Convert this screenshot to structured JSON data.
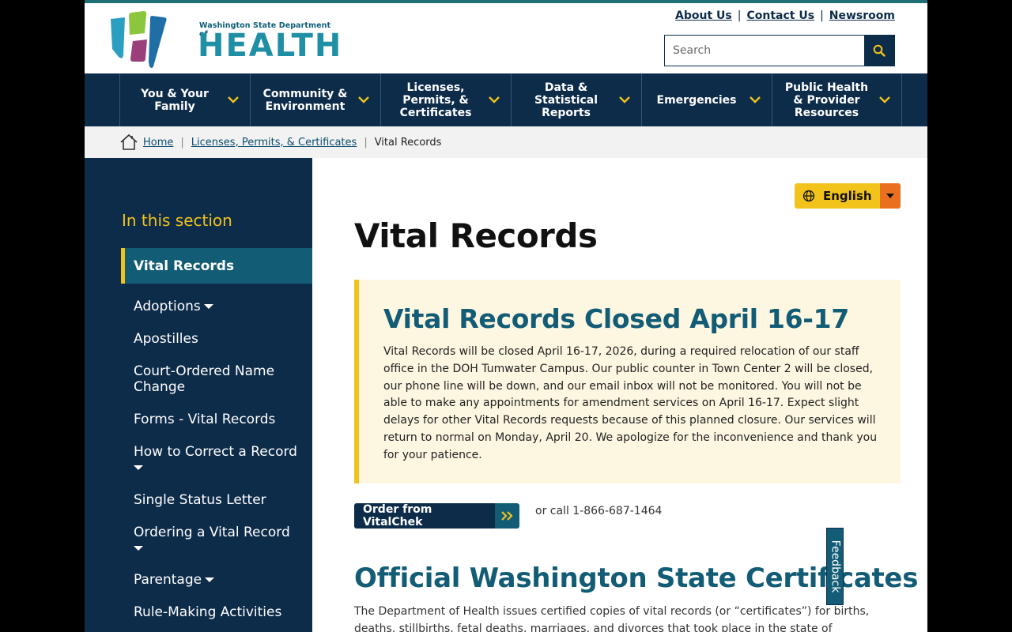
{
  "header": {
    "logo_small": "Washington State Department of",
    "logo_big": "HEALTH",
    "utility_links": [
      "About Us",
      "Contact Us",
      "Newsroom"
    ],
    "search_placeholder": "Search"
  },
  "nav": {
    "items": [
      [
        "You & Your",
        "Family"
      ],
      [
        "Community &",
        "Environment"
      ],
      [
        "Licenses,",
        "Permits, &",
        "Certificates"
      ],
      [
        "Data &",
        "Statistical",
        "Reports"
      ],
      [
        "Emergencies"
      ],
      [
        "Public Health",
        "& Provider",
        "Resources"
      ]
    ]
  },
  "breadcrumb": {
    "home": "Home",
    "parent": "Licenses, Permits, & Certificates",
    "current": "Vital Records"
  },
  "sidebar": {
    "title": "In this section",
    "active": "Vital Records",
    "items": [
      {
        "label": "Adoptions",
        "expand": true
      },
      {
        "label": "Apostilles",
        "expand": false
      },
      {
        "label": "Court-Ordered Name Change",
        "expand": false
      },
      {
        "label": "Forms - Vital Records",
        "expand": false
      },
      {
        "label": "How to Correct a Record",
        "expand": true
      },
      {
        "label": "Single Status Letter",
        "expand": false
      },
      {
        "label": "Ordering a Vital Record",
        "expand": true
      },
      {
        "label": "Parentage",
        "expand": true
      },
      {
        "label": "Rule-Making Activities",
        "expand": false
      }
    ]
  },
  "language": {
    "label": "English"
  },
  "main": {
    "title": "Vital Records",
    "alert_title": "Vital Records Closed April 16-17",
    "alert_body": "Vital Records will be closed April 16-17, 2026, during a required relocation of our staff office in the DOH Tumwater Campus. Our public counter in Town Center 2 will be closed, our phone line will be down, and our email inbox will not be monitored. You will not be able to make any appointments for amendment services on April 16-17. Expect slight delays for other Vital Records requests because of this planned closure. Our services will return to normal on Monday, April 20. We apologize for the inconvenience and thank you for your patience.",
    "order_button": "Order from VitalChek",
    "call_text": "or call 1-866-687-1464",
    "section_title": "Official Washington State Certificates",
    "intro": "The Department of Health issues certified copies of vital records (or “certificates”) for births, deaths, stillbirths, fetal deaths, marriages, and divorces that took place in the state of Washington."
  },
  "feedback": {
    "label": "Feedback"
  },
  "colors": {
    "navy": "#0d2c4a",
    "teal": "#135c75",
    "gold": "#f2c31b",
    "orange": "#e8701f",
    "alert_bg": "#fdf6e1"
  }
}
